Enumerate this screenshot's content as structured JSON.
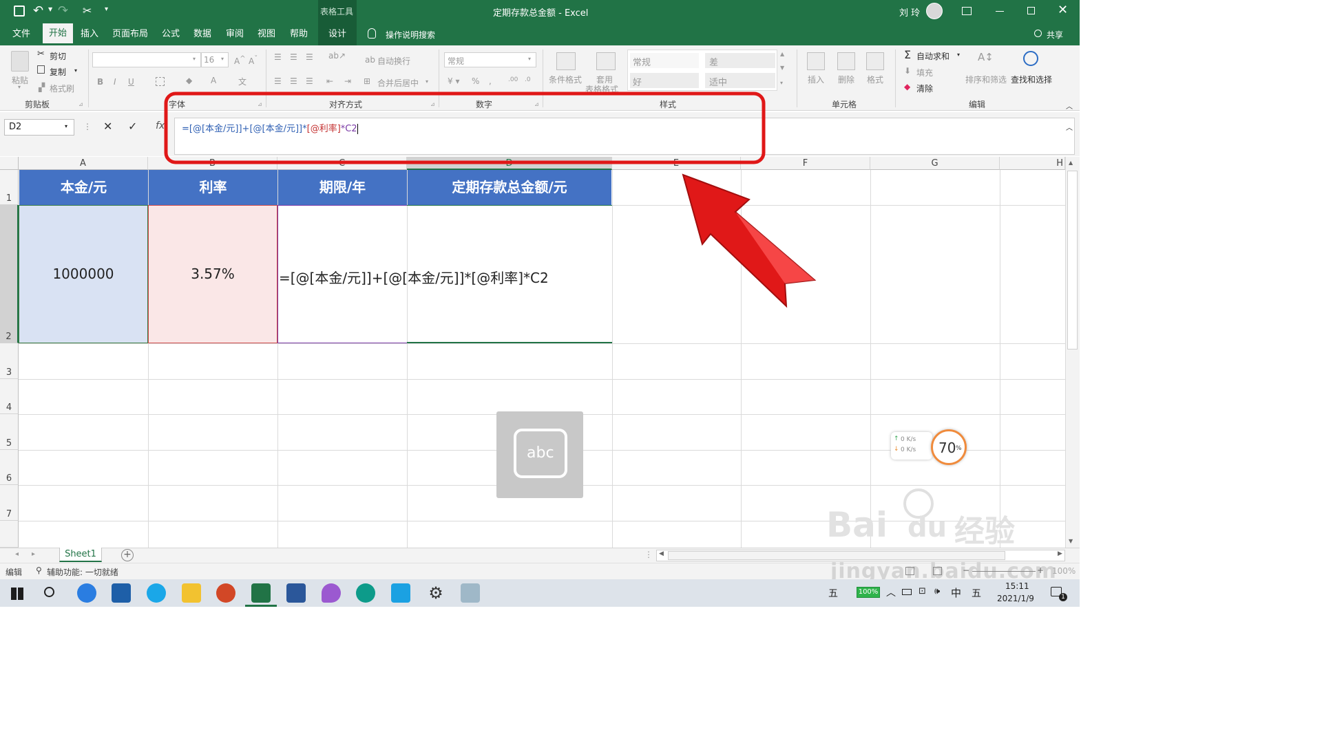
{
  "titlebar": {
    "context_tab": "表格工具",
    "doc_title": "定期存款总金额 - Excel",
    "user_name": "刘 玲"
  },
  "ribbon_tabs": [
    "文件",
    "开始",
    "插入",
    "页面布局",
    "公式",
    "数据",
    "审阅",
    "视图",
    "帮助",
    "设计"
  ],
  "tell_me": "操作说明搜索",
  "share": "共享",
  "clipboard": {
    "paste": "粘贴",
    "cut": "剪切",
    "copy": "复制",
    "format_painter": "格式刷",
    "label": "剪贴板"
  },
  "font": {
    "size": "16",
    "label": "字体"
  },
  "alignment": {
    "wrap": "自动换行",
    "merge": "合并后居中",
    "label": "对齐方式"
  },
  "number": {
    "format": "常规",
    "label": "数字"
  },
  "styles": {
    "conditional": "条件格式",
    "table_format": "套用\n表格格式",
    "normal": "常规",
    "bad": "差",
    "good": "好",
    "neutral": "适中",
    "label": "样式"
  },
  "cells": {
    "insert": "插入",
    "delete": "删除",
    "format": "格式",
    "label": "单元格"
  },
  "editing": {
    "autosum": "自动求和",
    "fill": "填充",
    "clear": "清除",
    "sort_filter": "排序和筛选",
    "find_select": "查找和选择",
    "label": "编辑"
  },
  "formula_bar": {
    "name_box": "D2",
    "fx": "fx",
    "formula_parts": [
      "=[@[本金/元]]+[@[本金/元]]*",
      "[@利率]",
      "*C2"
    ]
  },
  "columns": [
    "A",
    "B",
    "C",
    "D",
    "E",
    "F",
    "G",
    "H"
  ],
  "rows": [
    "1",
    "2",
    "3",
    "4",
    "5",
    "6",
    "7"
  ],
  "table": {
    "headers": [
      "本金/元",
      "利率",
      "期限/年",
      "定期存款总金额/元"
    ],
    "principal": "1000000",
    "rate": "3.57%",
    "formula_display": "=[@[本金/元]]+[@[本金/元]]*[@利率]*C2"
  },
  "ime_box": "abc",
  "netspeed": {
    "up": "0 K/s",
    "down": "0 K/s",
    "percent": "70",
    "unit": "%"
  },
  "sheet_tab": "Sheet1",
  "status": {
    "mode": "编辑",
    "accessibility": "辅助功能: 一切就绪",
    "zoom": "100%"
  },
  "watermark": {
    "brand": "Bai",
    "brand2": "du",
    "brand3": "经验",
    "url": "jingyan.baidu.com"
  },
  "taskbar": {
    "battery": "100%",
    "ime1": "五",
    "lang": "中",
    "ime2": "五",
    "time": "15:11",
    "date": "2021/1/9",
    "notif": "1"
  },
  "colors": {
    "excel_green": "#217346",
    "header_blue": "#4472c4",
    "cell_a2": "#d9e2f3",
    "cell_b2": "#fae7e7",
    "highlight_red": "#e01818"
  }
}
